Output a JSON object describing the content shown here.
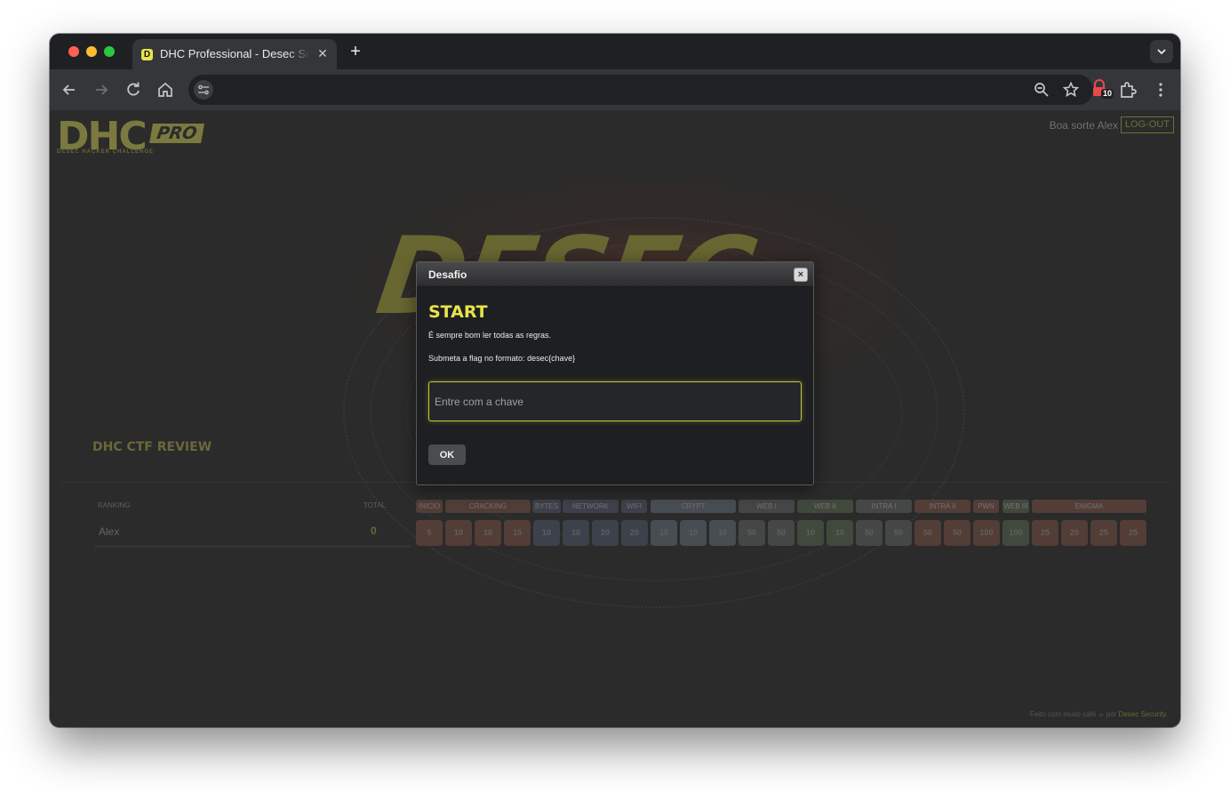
{
  "browser": {
    "tab_title": "DHC Professional - Desec Security",
    "tab_favicon_letter": "D",
    "extension_badge": "10"
  },
  "site": {
    "logo_main": "DHC",
    "logo_badge": "PRO",
    "logo_subtitle": "DESEC HACKER CHALLENGE",
    "hero_text": "DESEC",
    "greeting": "Boa sorte Alex",
    "logout_label": "LOG-OUT",
    "section_title": "DHC CTF REVIEW",
    "ranking_label": "RANKING",
    "total_label": "TOTAL",
    "player_name": "Alex",
    "player_total": "0",
    "categories": [
      {
        "label": "INICIO",
        "color": "#5a3a33"
      },
      {
        "label": "CRACKING",
        "color": "#5a3a33"
      },
      {
        "label": "BYTES",
        "color": "#3a4052"
      },
      {
        "label": "NETWORK",
        "color": "#3a4052"
      },
      {
        "label": "WIFI",
        "color": "#3a4052"
      },
      {
        "label": "CRYPT",
        "color": "#4a5260"
      },
      {
        "label": "WEB I",
        "color": "#45474a"
      },
      {
        "label": "WEB II",
        "color": "#3f4c3c"
      },
      {
        "label": "INTRA I",
        "color": "#45474a"
      },
      {
        "label": "INTRA II",
        "color": "#5a3a33"
      },
      {
        "label": "PWN",
        "color": "#5a3a33"
      },
      {
        "label": "WEB III",
        "color": "#3f4c3c"
      },
      {
        "label": "ENIGMA",
        "color": "#5a3a33"
      }
    ],
    "scores": [
      "5",
      "10",
      "10",
      "15",
      "10",
      "10",
      "20",
      "20",
      "10",
      "10",
      "10",
      "50",
      "50",
      "10",
      "10",
      "50",
      "50",
      "50",
      "50",
      "100",
      "100",
      "25",
      "25",
      "25",
      "25"
    ],
    "footer_prefix": "Feito com muito café ☕ por ",
    "footer_brand": "Desec Security."
  },
  "modal": {
    "title": "Desafio",
    "close_symbol": "×",
    "challenge_name": "START",
    "desc_line1": "É sempre bom ler todas as regras.",
    "desc_line2": "Submeta a flag no formato: desec{chave}",
    "input_placeholder": "Entre com a chave",
    "input_value": "",
    "ok_label": "OK"
  }
}
